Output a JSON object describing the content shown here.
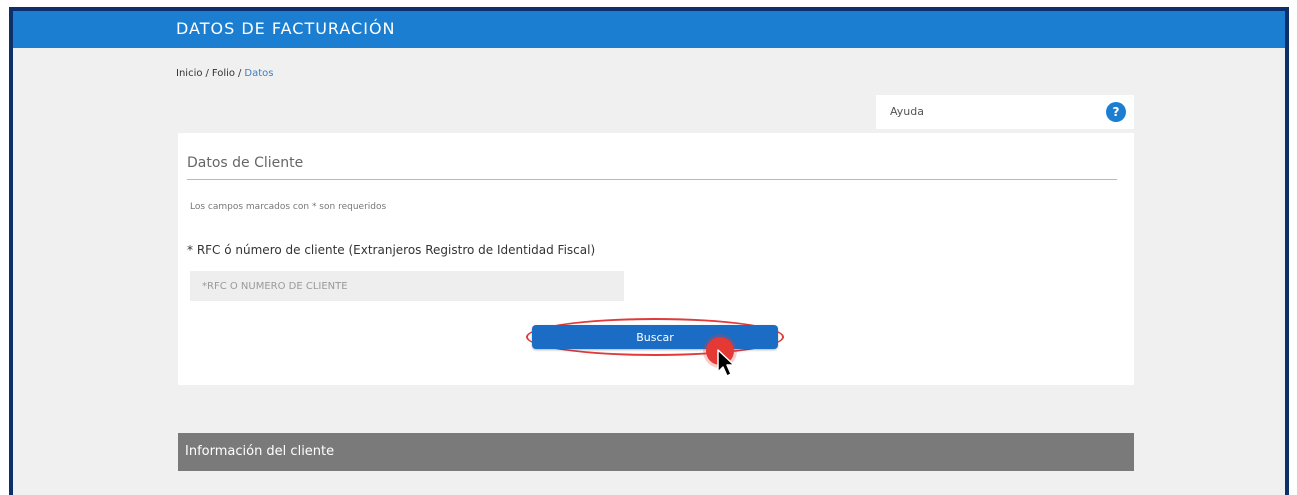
{
  "header": {
    "title": "DATOS DE FACTURACIÓN"
  },
  "breadcrumb": {
    "items": [
      "Inicio",
      "Folio",
      "Datos"
    ],
    "separator": "/"
  },
  "help": {
    "label": "Ayuda",
    "icon": "?"
  },
  "client_form": {
    "title": "Datos de Cliente",
    "required_note": "Los campos marcados con * son requeridos",
    "rfc_label": "* RFC ó número de cliente (Extranjeros Registro de Identidad Fiscal)",
    "rfc_placeholder": "*RFC Ó NÚMERO DE CLIENTE",
    "search_button": "Buscar"
  },
  "client_info": {
    "title": "Información del cliente"
  },
  "colors": {
    "header_bg": "#1b7ed1",
    "button_bg": "#1a6cc4",
    "highlight": "#e03a3a",
    "section_header_bg": "#7a7a7a"
  }
}
